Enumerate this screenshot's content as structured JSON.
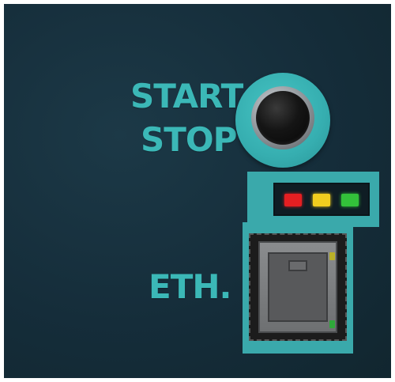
{
  "labels": {
    "start": "START",
    "stop": "STOP",
    "eth": "ETH."
  },
  "start_stop_button": {
    "icon": "push-button"
  },
  "status_leds": [
    {
      "name": "red",
      "color": "#e41f22"
    },
    {
      "name": "yellow",
      "color": "#f0cd1f"
    },
    {
      "name": "green",
      "color": "#33c13a"
    }
  ],
  "ethernet_port": {
    "icon": "rj45-port",
    "link_led_color": "#b9b028",
    "activity_led_color": "#2fa83a"
  },
  "colors": {
    "accent": "#3aa9ab",
    "background": "#152d3a"
  }
}
